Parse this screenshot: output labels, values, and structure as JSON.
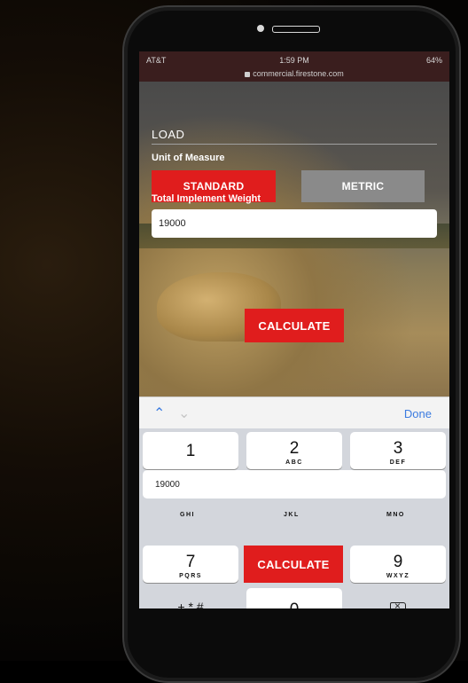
{
  "status_bar": {
    "carrier": "AT&T",
    "time": "1:59 PM",
    "battery": "64%",
    "url": "commercial.firestone.com"
  },
  "form": {
    "section_title": "LOAD",
    "unit_label": "Unit of Measure",
    "standard_button": "STANDARD",
    "metric_button": "METRIC",
    "weight_label": "Total Implement Weight",
    "weight_value": "19000",
    "calculate_button": "CALCULATE"
  },
  "accessory_bar": {
    "up_icon": "chevron-up-icon",
    "down_icon": "chevron-down-icon",
    "done_label": "Done"
  },
  "keypad": {
    "keys": [
      {
        "num": "1",
        "letters": ""
      },
      {
        "num": "2",
        "letters": "ABC"
      },
      {
        "num": "3",
        "letters": "DEF"
      },
      {
        "num": "7",
        "letters": "PQRS"
      },
      {
        "num": "9",
        "letters": "WXYZ"
      },
      {
        "num": "0",
        "letters": ""
      }
    ],
    "middle_row_letters": [
      "GHI",
      "JKL",
      "MNO"
    ],
    "suggestion": "19000",
    "symbols_label": "+ * #",
    "calculate_overlay": "CALCULATE",
    "delete_icon": "backspace-icon"
  },
  "colors": {
    "accent_red": "#e01d1d",
    "inactive_gray": "#8a8a8a",
    "ios_blue": "#3b7be0"
  }
}
